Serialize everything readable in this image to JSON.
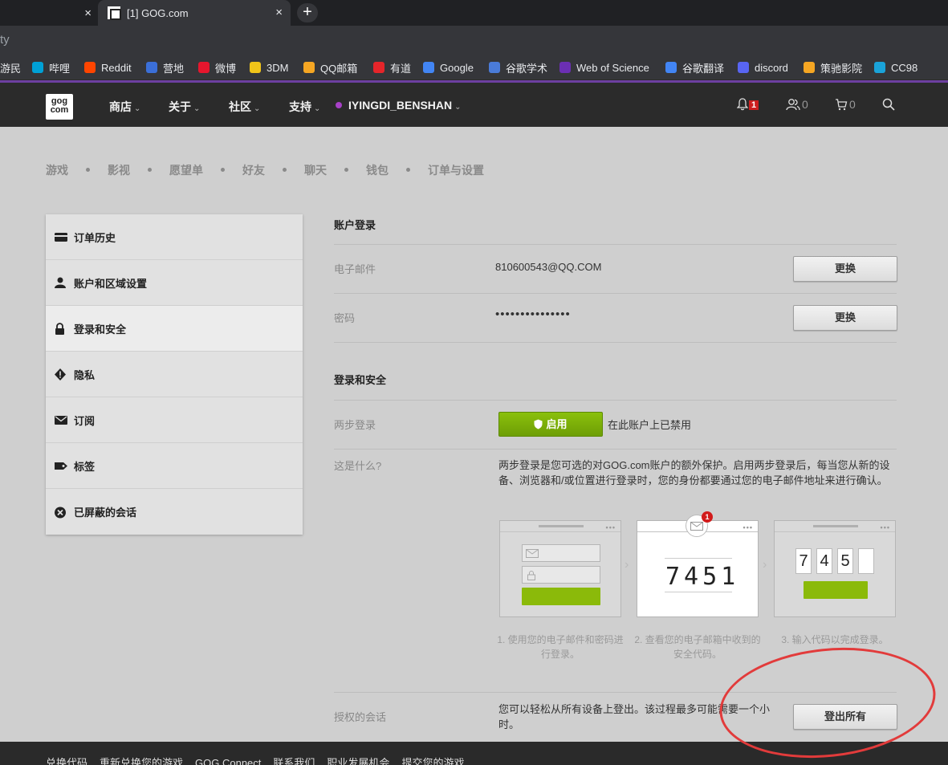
{
  "browser": {
    "tabs": [
      {
        "title": "",
        "close": "×"
      },
      {
        "title": "[1] GOG.com",
        "close": "×"
      }
    ],
    "new_tab": "+",
    "address": "ty",
    "bookmarks": [
      {
        "label": "游民",
        "color": "#c0392b"
      },
      {
        "label": "哔哩",
        "color": "#00a1d6"
      },
      {
        "label": "Reddit",
        "color": "#ff4500"
      },
      {
        "label": "营地",
        "color": "#3b6fd8"
      },
      {
        "label": "微博",
        "color": "#e6162d"
      },
      {
        "label": "3DM",
        "color": "#f0c419"
      },
      {
        "label": "QQ邮箱",
        "color": "#f5a623"
      },
      {
        "label": "有道",
        "color": "#e5252a"
      },
      {
        "label": "Google",
        "color": "#4285f4"
      },
      {
        "label": "谷歌学术",
        "color": "#4a7bd8"
      },
      {
        "label": "Web of Science",
        "color": "#6b2fb3"
      },
      {
        "label": "谷歌翻译",
        "color": "#4285f4"
      },
      {
        "label": "discord",
        "color": "#5865f2"
      },
      {
        "label": "策驰影院",
        "color": "#f5a623"
      },
      {
        "label": "CC98",
        "color": "#1aa3d9"
      }
    ]
  },
  "header": {
    "logo_top": "gog",
    "logo_bottom": "com",
    "nav": [
      "商店",
      "关于",
      "社区",
      "支持"
    ],
    "username": "IYINGDI_BENSHAN",
    "notifications": "1",
    "friends": "0",
    "cart": "0"
  },
  "subnav": [
    "游戏",
    "影视",
    "愿望单",
    "好友",
    "聊天",
    "钱包",
    "订单与设置"
  ],
  "sidebar": [
    "订单历史",
    "账户和区域设置",
    "登录和安全",
    "隐私",
    "订阅",
    "标签",
    "已屏蔽的会话"
  ],
  "account_login": {
    "title": "账户登录",
    "email_label": "电子邮件",
    "email_value": "810600543@QQ.COM",
    "password_label": "密码",
    "password_value": "•••••••••••••••",
    "change_label": "更换"
  },
  "security": {
    "title": "登录和安全",
    "two_step_label": "两步登录",
    "enable_button": "启用",
    "status": "在此账户上已禁用",
    "what_label": "这是什么?",
    "description": "两步登录是您可选的对GOG.com账户的额外保护。启用两步登录后，每当您从新的设备、浏览器和/或位置进行登录时，您的身份都要通过您的电子邮件地址来进行确认。",
    "code": "7451",
    "code_digits": [
      "7",
      "4",
      "5",
      ""
    ],
    "mail_badge": "1",
    "steps": [
      "1. 使用您的电子邮件和密码进行登录。",
      "2. 查看您的电子邮箱中收到的安全代码。",
      "3. 输入代码以完成登录。"
    ],
    "sessions_label": "授权的会话",
    "sessions_text": "您可以轻松从所有设备上登出。该过程最多可能需要一个小时。",
    "logout_button": "登出所有"
  },
  "footer": {
    "links": [
      "兑换代码",
      "重新兑换您的游戏",
      "GOG Connect",
      "联系我们",
      "职业发展机会",
      "提交您的游戏"
    ]
  },
  "colors": {
    "accent_green": "#7cb209",
    "annotation": "#e23b3b",
    "header_bg": "#2b2b2b"
  }
}
